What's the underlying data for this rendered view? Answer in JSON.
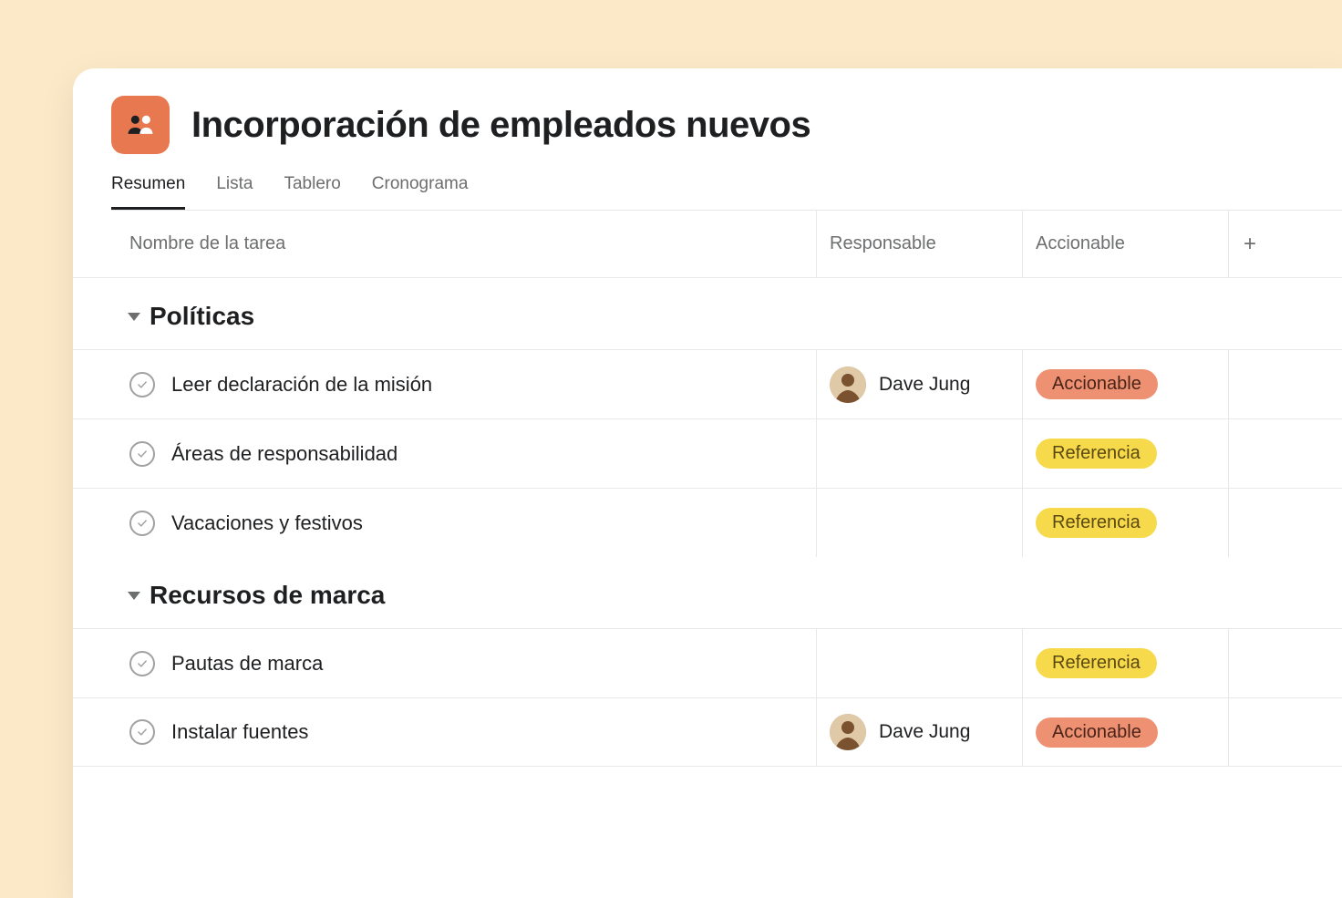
{
  "project": {
    "title": "Incorporación de empleados nuevos"
  },
  "tabs": [
    {
      "label": "Resumen",
      "active": true
    },
    {
      "label": "Lista",
      "active": false
    },
    {
      "label": "Tablero",
      "active": false
    },
    {
      "label": "Cronograma",
      "active": false
    }
  ],
  "columns": {
    "task": "Nombre de la tarea",
    "assignee": "Responsable",
    "action": "Accionable"
  },
  "pills": {
    "actionable": {
      "label": "Accionable",
      "style": "orange"
    },
    "reference": {
      "label": "Referencia",
      "style": "yellow"
    }
  },
  "assignees": {
    "dave": {
      "name": "Dave Jung"
    }
  },
  "sections": [
    {
      "title": "Políticas",
      "tasks": [
        {
          "name": "Leer declaración de la misión",
          "assignee": "dave",
          "tag": "actionable"
        },
        {
          "name": "Áreas de responsabilidad",
          "assignee": null,
          "tag": "reference"
        },
        {
          "name": "Vacaciones y festivos",
          "assignee": null,
          "tag": "reference"
        }
      ]
    },
    {
      "title": "Recursos de marca",
      "tasks": [
        {
          "name": "Pautas de marca",
          "assignee": null,
          "tag": "reference"
        },
        {
          "name": "Instalar fuentes",
          "assignee": "dave",
          "tag": "actionable"
        }
      ]
    }
  ]
}
